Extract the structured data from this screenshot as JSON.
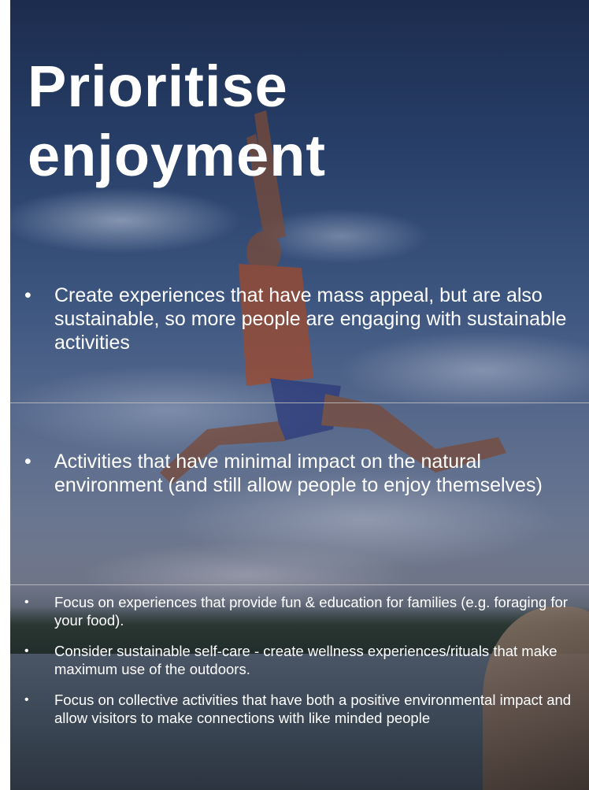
{
  "slide": {
    "title": "Prioritise\nenjoyment",
    "sections": [
      {
        "bullets": [
          "Create experiences that have mass appeal, but are also sustainable, so more people are engaging with sustainable activities"
        ]
      },
      {
        "bullets": [
          "Activities that have minimal impact on the natural environment (and still allow people to enjoy themselves)"
        ]
      },
      {
        "bullets": [
          "Focus on experiences that provide fun & education for families (e.g. foraging for your food).",
          "Consider sustainable self-care - create wellness experiences/rituals that make maximum use of the outdoors.",
          "Focus on collective activities that have both a positive environmental impact and allow visitors to make connections with like minded people"
        ]
      }
    ],
    "bullet_glyph": "•"
  }
}
